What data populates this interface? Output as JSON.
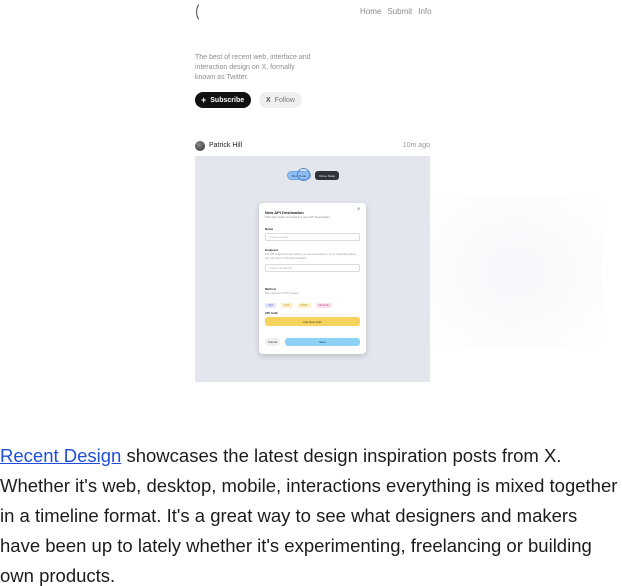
{
  "nav": {
    "items": [
      "Home",
      "Submit",
      "Info"
    ]
  },
  "intro": {
    "text": "The best of recent web, interface and interaction design on X, formally known as Twitter."
  },
  "buttons": {
    "subscribe": "Subscribe",
    "follow": "Follow"
  },
  "post": {
    "author": "Patrick Hill",
    "time": "10m ago",
    "image": {
      "pill_primary": "Boot Node",
      "pill_secondary": "Clone Node",
      "modal": {
        "title": "New API Destination",
        "subtitle": "This will create and attach a new API Destination",
        "name_label": "Name",
        "name_placeholder": "Custom model",
        "endpoint_label": "Endpoint",
        "endpoint_desc": "The API endpoint for the service you are connecting to. If you need help setting this, see docs on the documentation.",
        "endpoint_placeholder": "Custom Endpoint",
        "method_label": "Method",
        "method_desc": "The method of HTTP request",
        "methods": [
          "GET",
          "PUT",
          "POST",
          "DELETE"
        ],
        "auth_label": "API Auth",
        "auth_button": "Add New Auth",
        "cancel": "Cancel",
        "save": "Save"
      }
    }
  },
  "description": {
    "link_text": "Recent Design",
    "text": " showcases the latest design inspiration posts from X. Whether it's web, desktop, mobile, interactions everything is mixed together in a timeline format. It's a great way to see what designers and makers have been up to lately whether it's experimenting, freelancing or building own products."
  },
  "colors": {
    "link": "#1d4fd8",
    "subscribe_bg": "#111111",
    "canvas_bg": "#e3e6ed"
  }
}
